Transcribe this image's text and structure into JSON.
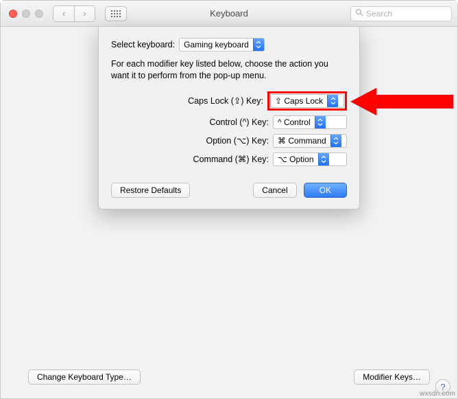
{
  "window": {
    "title": "Keyboard",
    "searchPlaceholder": "Search"
  },
  "dialog": {
    "selectKeyboardLabel": "Select keyboard:",
    "keyboardSelected": "Gaming keyboard",
    "instructions": "For each modifier key listed below, choose the action you want it to perform from the pop-up menu.",
    "rows": [
      {
        "label": "Caps Lock (⇪) Key:",
        "value": "⇪ Caps Lock",
        "highlighted": true,
        "name": "caps-lock"
      },
      {
        "label": "Control (^) Key:",
        "value": "^ Control",
        "highlighted": false,
        "name": "control"
      },
      {
        "label": "Option (⌥) Key:",
        "value": "⌘ Command",
        "highlighted": false,
        "name": "option"
      },
      {
        "label": "Command (⌘) Key:",
        "value": "⌥ Option",
        "highlighted": false,
        "name": "command"
      }
    ],
    "restoreDefaults": "Restore Defaults",
    "cancel": "Cancel",
    "ok": "OK"
  },
  "bottomButtons": {
    "changeKeyboardType": "Change Keyboard Type…",
    "modifierKeys": "Modifier Keys…"
  },
  "helpLabel": "?",
  "watermark": "wxsdn.com",
  "colors": {
    "accentRed": "#ff0000",
    "primaryBlue": "#2f7af3"
  }
}
